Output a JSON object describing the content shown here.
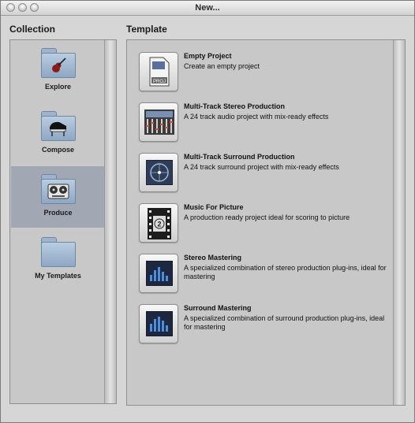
{
  "window": {
    "title": "New..."
  },
  "collection": {
    "header": "Collection",
    "items": [
      {
        "label": "Explore",
        "icon": "guitar-icon",
        "selected": false
      },
      {
        "label": "Compose",
        "icon": "piano-icon",
        "selected": false
      },
      {
        "label": "Produce",
        "icon": "tape-reel-icon",
        "selected": true
      },
      {
        "label": "My Templates",
        "icon": "folder-icon",
        "selected": false
      }
    ]
  },
  "template": {
    "header": "Template",
    "items": [
      {
        "name": "Empty Project",
        "description": "Create an empty project",
        "icon": "proj-document-icon"
      },
      {
        "name": "Multi-Track Stereo Production",
        "description": "A 24 track audio project with mix-ready effects",
        "icon": "mixer-icon"
      },
      {
        "name": "Multi-Track Surround Production",
        "description": "A 24 track surround project with mix-ready effects",
        "icon": "surround-panner-icon"
      },
      {
        "name": "Music For Picture",
        "description": "A production ready project ideal for scoring to picture",
        "icon": "film-countdown-icon"
      },
      {
        "name": "Stereo Mastering",
        "description": "A specialized combination of stereo production plug-ins, ideal for mastering",
        "icon": "meter-display-icon"
      },
      {
        "name": "Surround Mastering",
        "description": "A specialized combination of surround production plug-ins, ideal for mastering",
        "icon": "meter-display-icon"
      }
    ]
  }
}
